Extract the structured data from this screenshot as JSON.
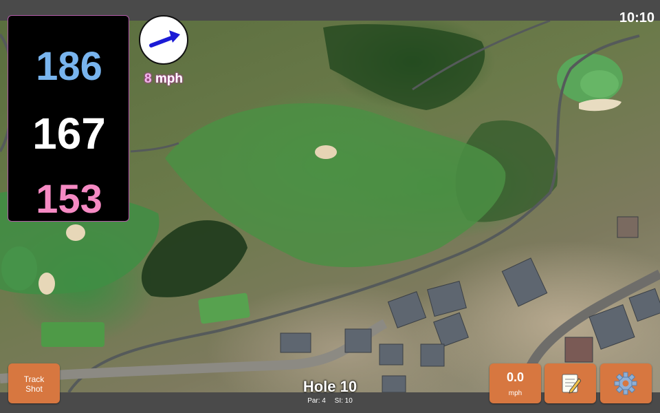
{
  "status": {
    "time": "10:10"
  },
  "distances": {
    "back": "186",
    "middle": "167",
    "front": "153"
  },
  "wind": {
    "speed": "8",
    "unit": "mph",
    "direction_icon": "wind-arrow-icon"
  },
  "hole": {
    "title": "Hole 10",
    "par_label": "Par: 4",
    "si_label": "SI: 10"
  },
  "buttons": {
    "track_shot": {
      "line1": "Track",
      "line2": "Shot"
    },
    "speed": {
      "value": "0.0",
      "unit": "mph"
    },
    "notes_icon": "notepad-icon",
    "settings_icon": "gear-icon"
  },
  "colors": {
    "back_distance": "#78b4ee",
    "middle_distance": "#ffffff",
    "front_distance": "#f58ac3",
    "button_orange": "#d77740",
    "wind_arrow": "#1b1bd6"
  }
}
